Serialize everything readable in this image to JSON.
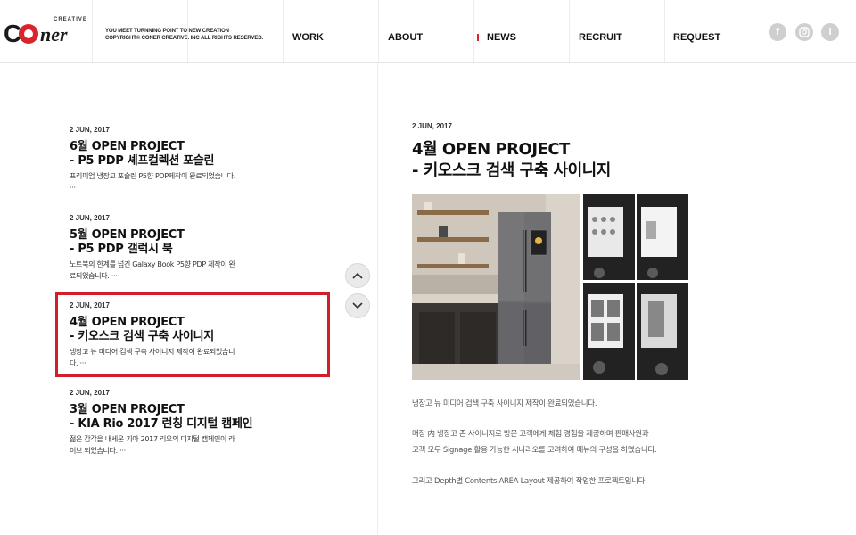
{
  "brand": {
    "logo_small": "CREATIVE",
    "logo_c": "C",
    "logo_ner": "ner",
    "tagline_line1": "YOU MEET TURNNING POINT TO NEW CREATION",
    "tagline_line2": "COPYRIGHT© CONER CREATIVE. INC ALL RIGHTS RESERVED."
  },
  "nav": {
    "work": "WORK",
    "about": "ABOUT",
    "news": "NEWS",
    "recruit": "RECRUIT",
    "request": "REQUEST",
    "active": "NEWS",
    "accent_color": "#d9232d"
  },
  "social": {
    "facebook_glyph": "f",
    "instagram_icon": "instagram-icon",
    "info_glyph": "i"
  },
  "news_list": [
    {
      "date": "2 JUN, 2017",
      "title_line1": "6월 OPEN PROJECT",
      "title_line2": "- P5 PDP 셰프컬렉션 포슬린",
      "desc": "프리미엄 냉장고 포슬린 P5향 PDP제작이 완료되었습니다. ···"
    },
    {
      "date": "2 JUN, 2017",
      "title_line1": "5월 OPEN PROJECT",
      "title_line2": "- P5 PDP 갤럭시 북",
      "desc": "노트북의 한계를 넘긴 Galaxy Book P5향 PDP 제작이 완료되었습니다. ···"
    },
    {
      "date": "2 JUN, 2017",
      "title_line1": "4월 OPEN PROJECT",
      "title_line2": "- 키오스크 검색 구축 사이니지",
      "desc": "냉장고 뉴 미디어 검색 구축 사이니지 제작이 완료되었습니다. ···"
    },
    {
      "date": "2 JUN, 2017",
      "title_line1": "3월 OPEN PROJECT",
      "title_line2": "- KIA Rio 2017 런칭 디지털 캠페인",
      "desc": "젊은 감각을 내세운 기아 2017 리오의 디지털 캠페인이 라이브 되었습니다. ···"
    }
  ],
  "selected_index": 2,
  "detail": {
    "date": "2 JUN, 2017",
    "title_line1": "4월 OPEN PROJECT",
    "title_line2": "- 키오스크 검색 구축 사이니지",
    "body_p1": "냉장고 뉴 미디어 검색 구축 사이니지 제작이 완료되었습니다.",
    "body_p2_line1": "매장 内 냉장고 존 사이니지로 방문 고객에게 체험 경험을 제공하며 판매사원과",
    "body_p2_line2": "고객 모두 Signage 활용 가능한 시나리오를 고려하여 메뉴의 구성을 하였습니다.",
    "body_p3": "그리고 Depth별 Contents AREA Layout 제공하여 작업한 프로젝트입니다."
  }
}
